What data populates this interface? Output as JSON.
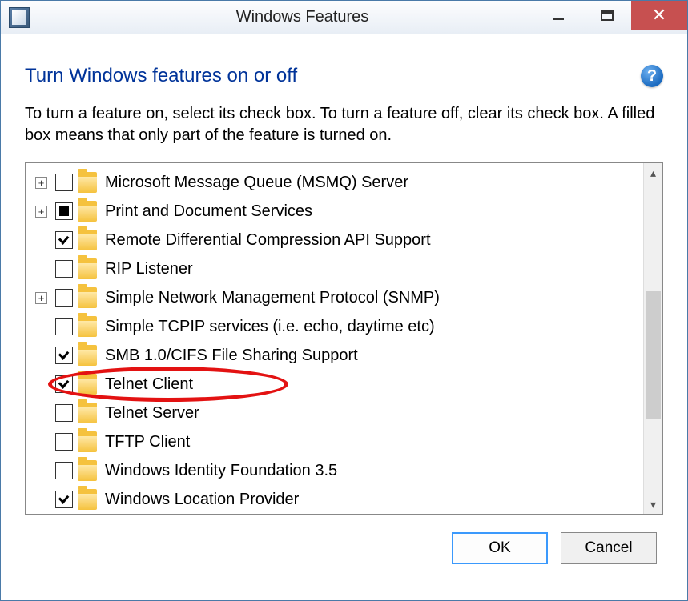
{
  "window": {
    "title": "Windows Features"
  },
  "header": {
    "heading": "Turn Windows features on or off",
    "subtext": "To turn a feature on, select its check box. To turn a feature off, clear its check box. A filled box means that only part of the feature is turned on."
  },
  "tree": {
    "items": [
      {
        "label": "Microsoft Message Queue (MSMQ) Server",
        "expandable": true,
        "checkbox": "unchecked"
      },
      {
        "label": "Print and Document Services",
        "expandable": true,
        "checkbox": "partial"
      },
      {
        "label": "Remote Differential Compression API Support",
        "expandable": false,
        "checkbox": "checked"
      },
      {
        "label": "RIP Listener",
        "expandable": false,
        "checkbox": "unchecked"
      },
      {
        "label": "Simple Network Management Protocol (SNMP)",
        "expandable": true,
        "checkbox": "unchecked"
      },
      {
        "label": "Simple TCPIP services (i.e. echo, daytime etc)",
        "expandable": false,
        "checkbox": "unchecked"
      },
      {
        "label": "SMB 1.0/CIFS File Sharing Support",
        "expandable": false,
        "checkbox": "checked"
      },
      {
        "label": "Telnet Client",
        "expandable": false,
        "checkbox": "checked",
        "highlighted": true
      },
      {
        "label": "Telnet Server",
        "expandable": false,
        "checkbox": "unchecked"
      },
      {
        "label": "TFTP Client",
        "expandable": false,
        "checkbox": "unchecked"
      },
      {
        "label": "Windows Identity Foundation 3.5",
        "expandable": false,
        "checkbox": "unchecked"
      },
      {
        "label": "Windows Location Provider",
        "expandable": false,
        "checkbox": "checked"
      }
    ]
  },
  "buttons": {
    "ok": "OK",
    "cancel": "Cancel"
  }
}
